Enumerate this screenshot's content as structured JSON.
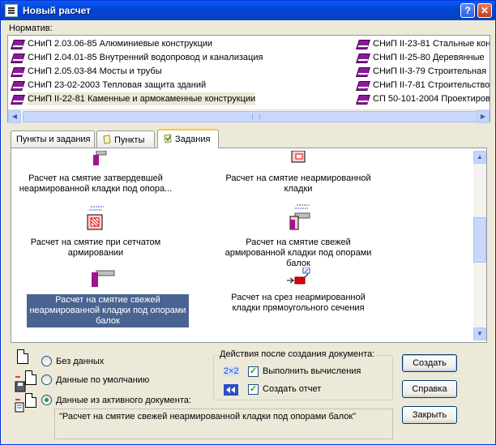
{
  "window": {
    "title": "Новый расчет"
  },
  "norms": {
    "label": "Норматив:",
    "col1": [
      "СНиП 2.03.06-85 Алюминиевые конструкции",
      "СНиП 2.04.01-85 Внутренний водопровод и канализация",
      "СНиП 2.05.03-84 Мосты и трубы",
      "СНиП 23-02-2003 Тепловая защита зданий",
      "СНиП II-22-81 Каменные и армокаменные конструкции"
    ],
    "col2": [
      "СНиП II-23-81 Стальные кон",
      "СНиП II-25-80 Деревянные",
      "СНиП II-3-79 Строительная",
      "СНиП II-7-81 Строительство",
      "СП 50-101-2004 Проектиров"
    ]
  },
  "tabs": [
    "Пункты и задания",
    "Пункты",
    "Задания"
  ],
  "tasks": [
    "Расчет на смятие затвердевшей неармированной кладки под опора...",
    "Расчет на смятие неармированной кладки",
    "Расчет на смятие при сетчатом армировании",
    "Расчет на смятие свежей армированной кладки под опорами балок",
    "Расчет на смятие свежей неармированной кладки под опорами балок",
    "Расчет на срез неармированной кладки прямоугольного сечения"
  ],
  "source": {
    "no_data": "Без данных",
    "defaults": "Данные по умолчанию",
    "active_doc": "Данные из активного документа:",
    "active_doc_value": "\"Расчет на смятие свежей неармированной кладки под опорами балок\""
  },
  "actions": {
    "title": "Действия после создания документа:",
    "calc_badge": "2×2",
    "calc": "Выполнить вычисления",
    "report": "Создать отчет"
  },
  "buttons": {
    "create": "Создать",
    "help": "Справка",
    "close": "Закрыть"
  },
  "colors": {
    "selection": "#4a6491",
    "book": "#8b1a9b",
    "titlebar": "#0a5cf5"
  }
}
